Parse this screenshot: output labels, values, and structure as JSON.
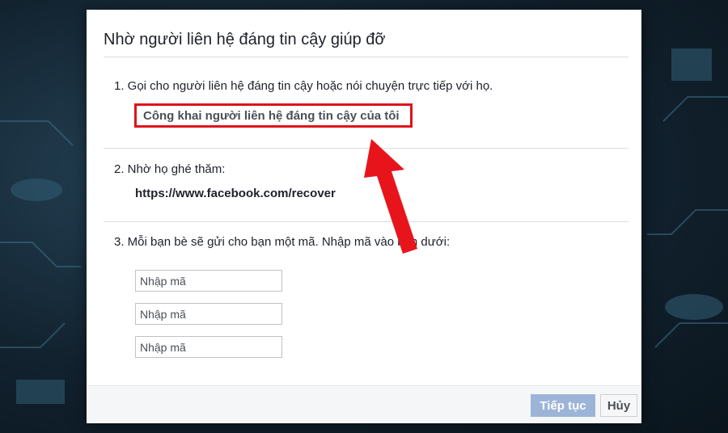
{
  "dialog": {
    "title": "Nhờ người liên hệ đáng tin cậy giúp đỡ",
    "step1": {
      "text": "1. Gọi cho người liên hệ đáng tin cậy hoặc nói chuyện trực tiếp với họ.",
      "reveal_button": "Công khai người liên hệ đáng tin cậy của tôi"
    },
    "step2": {
      "text": "2. Nhờ họ ghé thăm:",
      "url": "https://www.facebook.com/recover"
    },
    "step3": {
      "text": "3. Mỗi bạn bè sẽ gửi cho bạn một mã. Nhập mã vào bên dưới:",
      "inputs": [
        {
          "placeholder": "Nhập mã",
          "value": ""
        },
        {
          "placeholder": "Nhập mã",
          "value": ""
        },
        {
          "placeholder": "Nhập mã",
          "value": ""
        }
      ]
    },
    "footer": {
      "continue_label": "Tiếp tục",
      "cancel_label": "Hủy"
    }
  },
  "colors": {
    "highlight_border": "#e0121b",
    "arrow": "#e8141c",
    "continue_disabled": "#9cb4d8"
  },
  "icons": {
    "annotation": "red-arrow-icon"
  }
}
